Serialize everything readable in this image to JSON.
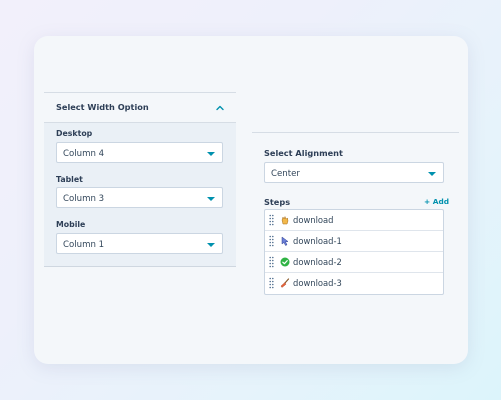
{
  "width_panel": {
    "title": "Select Width Option",
    "fields": [
      {
        "label": "Desktop",
        "value": "Column 4"
      },
      {
        "label": "Tablet",
        "value": "Column 3"
      },
      {
        "label": "Mobile",
        "value": "Column 1"
      }
    ]
  },
  "alignment": {
    "label": "Select Alignment",
    "value": "Center"
  },
  "steps": {
    "label": "Steps",
    "add_label": "+ Add",
    "items": [
      {
        "label": "download",
        "icon": "hand-icon"
      },
      {
        "label": "download-1",
        "icon": "pointer-icon"
      },
      {
        "label": "download-2",
        "icon": "check-circle-icon"
      },
      {
        "label": "download-3",
        "icon": "broom-icon"
      }
    ]
  },
  "colors": {
    "accent": "#0091ae",
    "check_green": "#2fb344",
    "text": "#2e3f57"
  }
}
